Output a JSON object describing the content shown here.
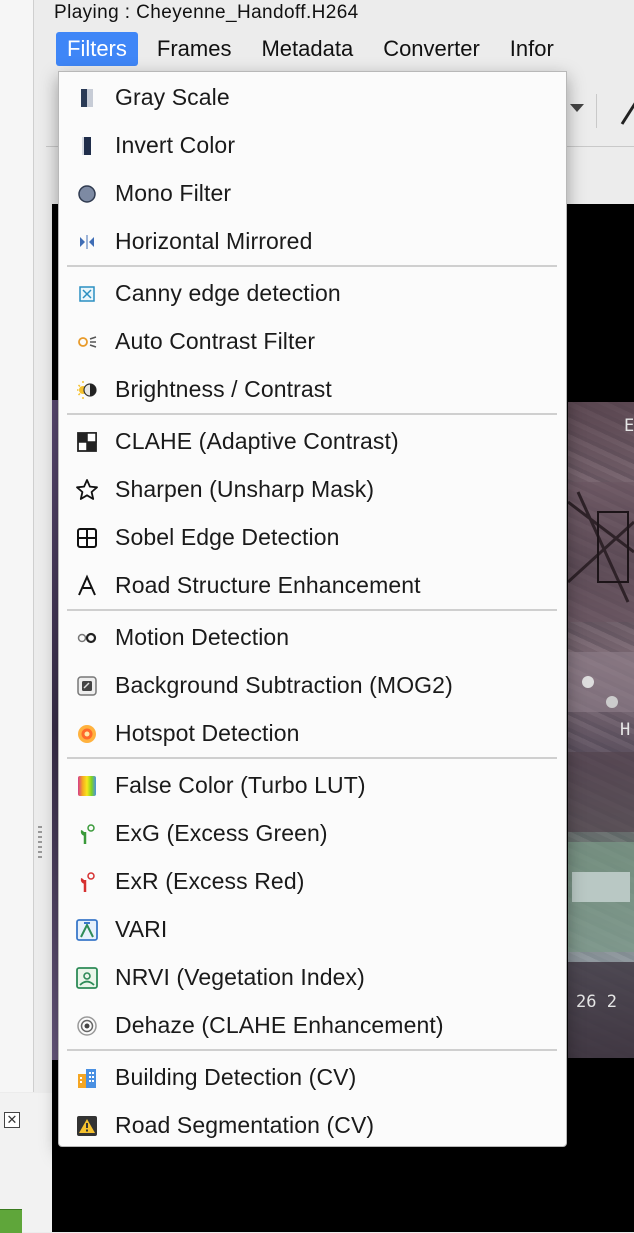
{
  "window": {
    "title": "Playing : Cheyenne_Handoff.H264"
  },
  "menubar": [
    {
      "label": "Filters",
      "active": true
    },
    {
      "label": "Frames"
    },
    {
      "label": "Metadata"
    },
    {
      "label": "Converter"
    },
    {
      "label": "Infor"
    }
  ],
  "video": {
    "overlay_top_right": "E",
    "overlay_mid_right": "H",
    "overlay_bottom_right": "26 2"
  },
  "filters_menu": {
    "items": [
      {
        "label": "Gray Scale",
        "icon": "gray-scale-icon"
      },
      {
        "label": "Invert Color",
        "icon": "invert-color-icon"
      },
      {
        "label": "Mono Filter",
        "icon": "mono-filter-icon"
      },
      {
        "label": "Horizontal Mirrored",
        "icon": "horizontal-mirror-icon"
      },
      {
        "label": "Canny edge detection",
        "icon": "canny-edge-icon"
      },
      {
        "label": "Auto Contrast Filter",
        "icon": "auto-contrast-icon"
      },
      {
        "label": "Brightness / Contrast",
        "icon": "brightness-contrast-icon"
      },
      {
        "label": "CLAHE (Adaptive Contrast)",
        "icon": "clahe-icon"
      },
      {
        "label": "Sharpen (Unsharp Mask)",
        "icon": "star-icon"
      },
      {
        "label": "Sobel Edge Detection",
        "icon": "sobel-grid-icon"
      },
      {
        "label": "Road  Structure Enhancement",
        "icon": "road-a-icon"
      },
      {
        "label": "Motion Detection",
        "icon": "motion-detection-icon"
      },
      {
        "label": "Background Subtraction (MOG2)",
        "icon": "background-subtraction-icon"
      },
      {
        "label": "Hotspot Detection",
        "icon": "hotspot-icon"
      },
      {
        "label": "False Color (Turbo LUT)",
        "icon": "false-color-icon"
      },
      {
        "label": "ExG (Excess Green)",
        "icon": "excess-green-icon"
      },
      {
        "label": "ExR (Excess Red)",
        "icon": "excess-red-icon"
      },
      {
        "label": "VARI",
        "icon": "vari-icon"
      },
      {
        "label": "NRVI (Vegetation Index)",
        "icon": "nrvi-icon"
      },
      {
        "label": "Dehaze (CLAHE Enhancement)",
        "icon": "dehaze-icon"
      },
      {
        "label": "Building Detection (CV)",
        "icon": "building-icon"
      },
      {
        "label": "Road Segmentation (CV)",
        "icon": "warning-icon"
      }
    ]
  },
  "colors": {
    "menu_highlight": "#3f86f7"
  }
}
